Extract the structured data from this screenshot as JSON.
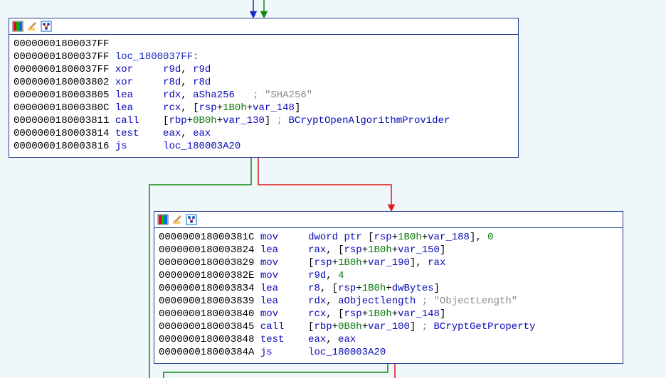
{
  "node1": {
    "lines": [
      {
        "addr": "00000001800037FF",
        "rest": []
      },
      {
        "addr": "00000001800037FF",
        "rest": [
          {
            "t": "lbl",
            "v": "loc_1800037FF:"
          }
        ]
      },
      {
        "addr": "00000001800037FF",
        "rest": [
          {
            "t": "mn",
            "v": "xor"
          },
          {
            "t": "pad",
            "v": "     "
          },
          {
            "t": "op",
            "v": "r9d"
          },
          {
            "t": "txt",
            "v": ", "
          },
          {
            "t": "op",
            "v": "r9d"
          }
        ]
      },
      {
        "addr": "0000000180003802",
        "rest": [
          {
            "t": "mn",
            "v": "xor"
          },
          {
            "t": "pad",
            "v": "     "
          },
          {
            "t": "op",
            "v": "r8d"
          },
          {
            "t": "txt",
            "v": ", "
          },
          {
            "t": "op",
            "v": "r8d"
          }
        ]
      },
      {
        "addr": "0000000180003805",
        "rest": [
          {
            "t": "mn",
            "v": "lea"
          },
          {
            "t": "pad",
            "v": "     "
          },
          {
            "t": "op",
            "v": "rdx"
          },
          {
            "t": "txt",
            "v": ", "
          },
          {
            "t": "op",
            "v": "aSha256"
          },
          {
            "t": "pad",
            "v": "   "
          },
          {
            "t": "cmt",
            "v": "; "
          },
          {
            "t": "str",
            "v": "\"SHA256\""
          }
        ]
      },
      {
        "addr": "000000018000380C",
        "rest": [
          {
            "t": "mn",
            "v": "lea"
          },
          {
            "t": "pad",
            "v": "     "
          },
          {
            "t": "op",
            "v": "rcx"
          },
          {
            "t": "txt",
            "v": ", ["
          },
          {
            "t": "op",
            "v": "rsp"
          },
          {
            "t": "txt",
            "v": "+"
          },
          {
            "t": "num",
            "v": "1B0h"
          },
          {
            "t": "txt",
            "v": "+"
          },
          {
            "t": "op",
            "v": "var_148"
          },
          {
            "t": "txt",
            "v": "]"
          }
        ]
      },
      {
        "addr": "0000000180003811",
        "rest": [
          {
            "t": "mn",
            "v": "call"
          },
          {
            "t": "pad",
            "v": "    "
          },
          {
            "t": "txt",
            "v": "["
          },
          {
            "t": "op",
            "v": "rbp"
          },
          {
            "t": "txt",
            "v": "+"
          },
          {
            "t": "num",
            "v": "0B0h"
          },
          {
            "t": "txt",
            "v": "+"
          },
          {
            "t": "op",
            "v": "var_130"
          },
          {
            "t": "txt",
            "v": "] "
          },
          {
            "t": "cmt",
            "v": "; "
          },
          {
            "t": "op",
            "v": "BCryptOpenAlgorithmProvider"
          }
        ]
      },
      {
        "addr": "0000000180003814",
        "rest": [
          {
            "t": "mn",
            "v": "test"
          },
          {
            "t": "pad",
            "v": "    "
          },
          {
            "t": "op",
            "v": "eax"
          },
          {
            "t": "txt",
            "v": ", "
          },
          {
            "t": "op",
            "v": "eax"
          }
        ]
      },
      {
        "addr": "0000000180003816",
        "rest": [
          {
            "t": "mn",
            "v": "js"
          },
          {
            "t": "pad",
            "v": "      "
          },
          {
            "t": "op",
            "v": "loc_180003A20"
          }
        ]
      }
    ]
  },
  "node2": {
    "lines": [
      {
        "addr": "000000018000381C",
        "rest": [
          {
            "t": "mn",
            "v": "mov"
          },
          {
            "t": "pad",
            "v": "     "
          },
          {
            "t": "op",
            "v": "dword ptr"
          },
          {
            "t": "txt",
            "v": " ["
          },
          {
            "t": "op",
            "v": "rsp"
          },
          {
            "t": "txt",
            "v": "+"
          },
          {
            "t": "num",
            "v": "1B0h"
          },
          {
            "t": "txt",
            "v": "+"
          },
          {
            "t": "op",
            "v": "var_188"
          },
          {
            "t": "txt",
            "v": "], "
          },
          {
            "t": "num",
            "v": "0"
          }
        ]
      },
      {
        "addr": "0000000180003824",
        "rest": [
          {
            "t": "mn",
            "v": "lea"
          },
          {
            "t": "pad",
            "v": "     "
          },
          {
            "t": "op",
            "v": "rax"
          },
          {
            "t": "txt",
            "v": ", ["
          },
          {
            "t": "op",
            "v": "rsp"
          },
          {
            "t": "txt",
            "v": "+"
          },
          {
            "t": "num",
            "v": "1B0h"
          },
          {
            "t": "txt",
            "v": "+"
          },
          {
            "t": "op",
            "v": "var_150"
          },
          {
            "t": "txt",
            "v": "]"
          }
        ]
      },
      {
        "addr": "0000000180003829",
        "rest": [
          {
            "t": "mn",
            "v": "mov"
          },
          {
            "t": "pad",
            "v": "     "
          },
          {
            "t": "txt",
            "v": "["
          },
          {
            "t": "op",
            "v": "rsp"
          },
          {
            "t": "txt",
            "v": "+"
          },
          {
            "t": "num",
            "v": "1B0h"
          },
          {
            "t": "txt",
            "v": "+"
          },
          {
            "t": "op",
            "v": "var_190"
          },
          {
            "t": "txt",
            "v": "], "
          },
          {
            "t": "op",
            "v": "rax"
          }
        ]
      },
      {
        "addr": "000000018000382E",
        "rest": [
          {
            "t": "mn",
            "v": "mov"
          },
          {
            "t": "pad",
            "v": "     "
          },
          {
            "t": "op",
            "v": "r9d"
          },
          {
            "t": "txt",
            "v": ", "
          },
          {
            "t": "num",
            "v": "4"
          }
        ]
      },
      {
        "addr": "0000000180003834",
        "rest": [
          {
            "t": "mn",
            "v": "lea"
          },
          {
            "t": "pad",
            "v": "     "
          },
          {
            "t": "op",
            "v": "r8"
          },
          {
            "t": "txt",
            "v": ", ["
          },
          {
            "t": "op",
            "v": "rsp"
          },
          {
            "t": "txt",
            "v": "+"
          },
          {
            "t": "num",
            "v": "1B0h"
          },
          {
            "t": "txt",
            "v": "+"
          },
          {
            "t": "op",
            "v": "dwBytes"
          },
          {
            "t": "txt",
            "v": "]"
          }
        ]
      },
      {
        "addr": "0000000180003839",
        "rest": [
          {
            "t": "mn",
            "v": "lea"
          },
          {
            "t": "pad",
            "v": "     "
          },
          {
            "t": "op",
            "v": "rdx"
          },
          {
            "t": "txt",
            "v": ", "
          },
          {
            "t": "op",
            "v": "aObjectlength"
          },
          {
            "t": "txt",
            "v": " "
          },
          {
            "t": "cmt",
            "v": "; "
          },
          {
            "t": "str",
            "v": "\"ObjectLength\""
          }
        ]
      },
      {
        "addr": "0000000180003840",
        "rest": [
          {
            "t": "mn",
            "v": "mov"
          },
          {
            "t": "pad",
            "v": "     "
          },
          {
            "t": "op",
            "v": "rcx"
          },
          {
            "t": "txt",
            "v": ", ["
          },
          {
            "t": "op",
            "v": "rsp"
          },
          {
            "t": "txt",
            "v": "+"
          },
          {
            "t": "num",
            "v": "1B0h"
          },
          {
            "t": "txt",
            "v": "+"
          },
          {
            "t": "op",
            "v": "var_148"
          },
          {
            "t": "txt",
            "v": "]"
          }
        ]
      },
      {
        "addr": "0000000180003845",
        "rest": [
          {
            "t": "mn",
            "v": "call"
          },
          {
            "t": "pad",
            "v": "    "
          },
          {
            "t": "txt",
            "v": "["
          },
          {
            "t": "op",
            "v": "rbp"
          },
          {
            "t": "txt",
            "v": "+"
          },
          {
            "t": "num",
            "v": "0B0h"
          },
          {
            "t": "txt",
            "v": "+"
          },
          {
            "t": "op",
            "v": "var_100"
          },
          {
            "t": "txt",
            "v": "] "
          },
          {
            "t": "cmt",
            "v": "; "
          },
          {
            "t": "op",
            "v": "BCryptGetProperty"
          }
        ]
      },
      {
        "addr": "0000000180003848",
        "rest": [
          {
            "t": "mn",
            "v": "test"
          },
          {
            "t": "pad",
            "v": "    "
          },
          {
            "t": "op",
            "v": "eax"
          },
          {
            "t": "txt",
            "v": ", "
          },
          {
            "t": "op",
            "v": "eax"
          }
        ]
      },
      {
        "addr": "000000018000384A",
        "rest": [
          {
            "t": "mn",
            "v": "js"
          },
          {
            "t": "pad",
            "v": "      "
          },
          {
            "t": "op",
            "v": "loc_180003A20"
          }
        ]
      }
    ]
  },
  "colors": {
    "edge_red": "#e01818",
    "edge_green": "#0c8a0c",
    "edge_blue": "#1928c0"
  }
}
